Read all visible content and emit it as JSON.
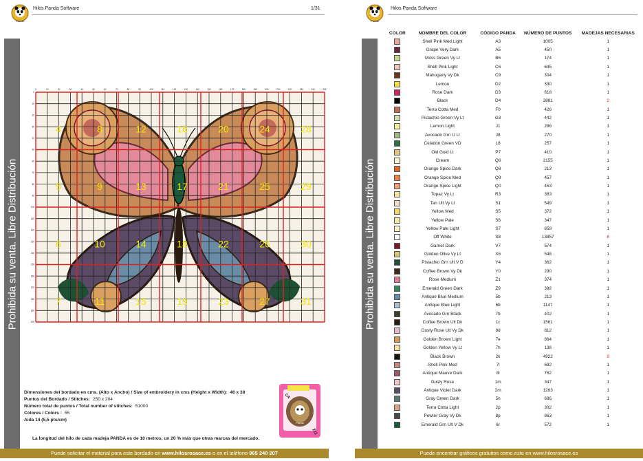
{
  "left_page": {
    "app_name": "Hilos Panda Software",
    "page_number": "1/31",
    "side_label": "Prohibida su venta. Libre Distribución",
    "logo_text": "Panda",
    "pattern": {
      "column_ticks": [
        "0",
        "10",
        "20",
        "30",
        "40",
        "50",
        "60",
        "70",
        "80",
        "90",
        "100",
        "110",
        "120",
        "130",
        "140",
        "150",
        "160",
        "170",
        "180",
        "190",
        "200",
        "210",
        "220",
        "230",
        "240",
        "250"
      ],
      "row_ticks": [
        "0",
        "10",
        "20",
        "30",
        "40",
        "50",
        "60",
        "70",
        "80",
        "90",
        "100",
        "110",
        "120",
        "130",
        "140",
        "150",
        "160",
        "170",
        "180",
        "190",
        "200"
      ],
      "page_labels": [
        "4",
        "8",
        "12",
        "16",
        "20",
        "24",
        "28",
        "5",
        "9",
        "13",
        "17",
        "21",
        "25",
        "29",
        "6",
        "10",
        "14",
        "18",
        "22",
        "26",
        "30",
        "7",
        "11",
        "15",
        "19",
        "23",
        "27",
        "31"
      ]
    },
    "specs": {
      "size_label": "Dimensiones del bordado en cms. (Alto x Ancho) / Size of embroidery in cms (Height x Width):",
      "size_value": "46 x 38",
      "stitches_label": "Puntos del Bordado / Stitches:",
      "stitches_value": "250 x 204",
      "total_label": "Número total de puntos / Total number of stitches:",
      "total_value": "51000",
      "colors_label": "Colores / Colors :",
      "colors_value": "55",
      "aida_label": "Aida 14 (5,5 pts/cm)"
    },
    "card": {
      "code": "C4",
      "number": "211",
      "brand": "Panda"
    },
    "note": "La longitud del hilo de cada madeja PANDA es de 10 metros, un 20 % más que otras marcas del mercado.",
    "footer_prefix": "Puede solicitar el material para este bordado en",
    "footer_site": "www.hilosrosace.es",
    "footer_mid": "o en el teléfono",
    "footer_phone": "965 240 207"
  },
  "right_page": {
    "app_name": "Hilos Panda Software",
    "side_label": "Prohibida su venta. Libre Distribución",
    "logo_text": "Panda",
    "headers": [
      "COLOR",
      "NOMBRE DEL COLOR",
      "CÓDIGO PANDA",
      "NÚMERO DE PUNTOS",
      "MADEJAS NECESARIAS"
    ],
    "rows": [
      {
        "color": "#e8a79c",
        "name": "Shell Pink Med Light",
        "code": "A3",
        "points": "1005",
        "skeins": "1"
      },
      {
        "color": "#6a2c37",
        "name": "Grape Very Dark",
        "code": "A5",
        "points": "450",
        "skeins": "1"
      },
      {
        "color": "#c6d88a",
        "name": "Moss Green Vy Lt",
        "code": "B6",
        "points": "174",
        "skeins": "1"
      },
      {
        "color": "#f2c7bd",
        "name": "Shell Pink Light",
        "code": "C6",
        "points": "645",
        "skeins": "1"
      },
      {
        "color": "#6b3818",
        "name": "Mahogany Vy Dk",
        "code": "C9",
        "points": "304",
        "skeins": "1"
      },
      {
        "color": "#f2e04a",
        "name": "Lemon",
        "code": "D2",
        "points": "330",
        "skeins": "1"
      },
      {
        "color": "#d0245a",
        "name": "Rose Dark",
        "code": "D3",
        "points": "618",
        "skeins": "1"
      },
      {
        "color": "#000000",
        "name": "Black",
        "code": "D4",
        "points": "3881",
        "skeins": "2",
        "skeins_red": true
      },
      {
        "color": "#c46a5a",
        "name": "Terra Cotta Med",
        "code": "F0",
        "points": "426",
        "skeins": "1"
      },
      {
        "color": "#c9e2b0",
        "name": "Pistachio Green Vy Lt",
        "code": "G3",
        "points": "442",
        "skeins": "1"
      },
      {
        "color": "#f6ee9c",
        "name": "Lemon Light",
        "code": "J1",
        "points": "286",
        "skeins": "1"
      },
      {
        "color": "#a4b883",
        "name": "Avocado Grn U Lt",
        "code": "J8",
        "points": "270",
        "skeins": "1"
      },
      {
        "color": "#2f6b45",
        "name": "Celadon Green VD",
        "code": "L8",
        "points": "257",
        "skeins": "1"
      },
      {
        "color": "#e7c27a",
        "name": "Old Gold Lt",
        "code": "P7",
        "points": "410",
        "skeins": "1"
      },
      {
        "color": "#fbf3d8",
        "name": "Cream",
        "code": "Q6",
        "points": "2155",
        "skeins": "1"
      },
      {
        "color": "#e56a2a",
        "name": "Orange Spice Dark",
        "code": "Q8",
        "points": "213",
        "skeins": "1"
      },
      {
        "color": "#f08448",
        "name": "Orange Spice Med",
        "code": "Q9",
        "points": "457",
        "skeins": "1"
      },
      {
        "color": "#f4a070",
        "name": "Orange Spice Light",
        "code": "Q0",
        "points": "453",
        "skeins": "1"
      },
      {
        "color": "#f8e3a0",
        "name": "Topaz Vy Lt",
        "code": "R3",
        "points": "383",
        "skeins": "1"
      },
      {
        "color": "#f6dcc4",
        "name": "Tan Ult Vy Lt",
        "code": "S1",
        "points": "549",
        "skeins": "1"
      },
      {
        "color": "#f5d56a",
        "name": "Yellow Med",
        "code": "S5",
        "points": "372",
        "skeins": "1"
      },
      {
        "color": "#f8e9a4",
        "name": "Yellow Pale",
        "code": "S6",
        "points": "347",
        "skeins": "1"
      },
      {
        "color": "#fbf0c8",
        "name": "Yellow Pale Light",
        "code": "S7",
        "points": "659",
        "skeins": "1"
      },
      {
        "color": "#fcfbf4",
        "name": "Off White",
        "code": "S8",
        "points": "13857",
        "skeins": "6",
        "skeins_red": true
      },
      {
        "color": "#7c1530",
        "name": "Garnet Dark",
        "code": "V7",
        "points": "574",
        "skeins": "1"
      },
      {
        "color": "#d6c77e",
        "name": "Golden Olive Vy Lt",
        "code": "X6",
        "points": "548",
        "skeins": "1"
      },
      {
        "color": "#1e5034",
        "name": "Pistachio Grn Ult V D",
        "code": "Y4",
        "points": "362",
        "skeins": "1"
      },
      {
        "color": "#3e2a1a",
        "name": "Coffee Brown Vy Dk",
        "code": "Y0",
        "points": "290",
        "skeins": "1"
      },
      {
        "color": "#e37e92",
        "name": "Rose Medium",
        "code": "Z1",
        "points": "374",
        "skeins": "1"
      },
      {
        "color": "#2e8a5a",
        "name": "Emerald Green Dark",
        "code": "Z9",
        "points": "392",
        "skeins": "1"
      },
      {
        "color": "#6a8ca6",
        "name": "Antique Blue Medium",
        "code": "5b",
        "points": "213",
        "skeins": "1"
      },
      {
        "color": "#a6c0d4",
        "name": "Antique Blue Light",
        "code": "6b",
        "points": "1147",
        "skeins": "1"
      },
      {
        "color": "#3a4024",
        "name": "Avocado Grn Black",
        "code": "7b",
        "points": "402",
        "skeins": "1"
      },
      {
        "color": "#2a1a10",
        "name": "Coffee Brown Ult Dk",
        "code": "1c",
        "points": "1561",
        "skeins": "1"
      },
      {
        "color": "#e8bcc4",
        "name": "Dusty Rose Ult Vy Dk",
        "code": "8d",
        "points": "812",
        "skeins": "1"
      },
      {
        "color": "#d89a52",
        "name": "Golden Brown Light",
        "code": "7e",
        "points": "864",
        "skeins": "1"
      },
      {
        "color": "#f2e0a0",
        "name": "Golden Yellow Vy Lt",
        "code": "7h",
        "points": "138",
        "skeins": "1"
      },
      {
        "color": "#1c100a",
        "name": "Black Brown",
        "code": "2k",
        "points": "4922",
        "skeins": "3",
        "skeins_red": true
      },
      {
        "color": "#c98a8a",
        "name": "Shell Pink Med",
        "code": "7l",
        "points": "692",
        "skeins": "1"
      },
      {
        "color": "#9a5a62",
        "name": "Antique Mauve Dark",
        "code": "8l",
        "points": "762",
        "skeins": "1"
      },
      {
        "color": "#f0c8cc",
        "name": "Dusty Rose",
        "code": "1m",
        "points": "347",
        "skeins": "1"
      },
      {
        "color": "#5a4a66",
        "name": "Antique Violet Dark",
        "code": "2m",
        "points": "1283",
        "skeins": "1"
      },
      {
        "color": "#5e7a6e",
        "name": "Gray Green Dark",
        "code": "5n",
        "points": "686",
        "skeins": "1"
      },
      {
        "color": "#e0a088",
        "name": "Terra Cotta Light",
        "code": "2p",
        "points": "302",
        "skeins": "1"
      },
      {
        "color": "#4a4a4a",
        "name": "Pewter Gray Vy Dk",
        "code": "8p",
        "points": "863",
        "skeins": "1"
      },
      {
        "color": "#1a5a3a",
        "name": "Emerald Grn Ult V Dk",
        "code": "6r",
        "points": "572",
        "skeins": "1"
      }
    ],
    "footer": "Puede encontrar gráficos gratuitos como este en www.hilosrosace.es"
  }
}
